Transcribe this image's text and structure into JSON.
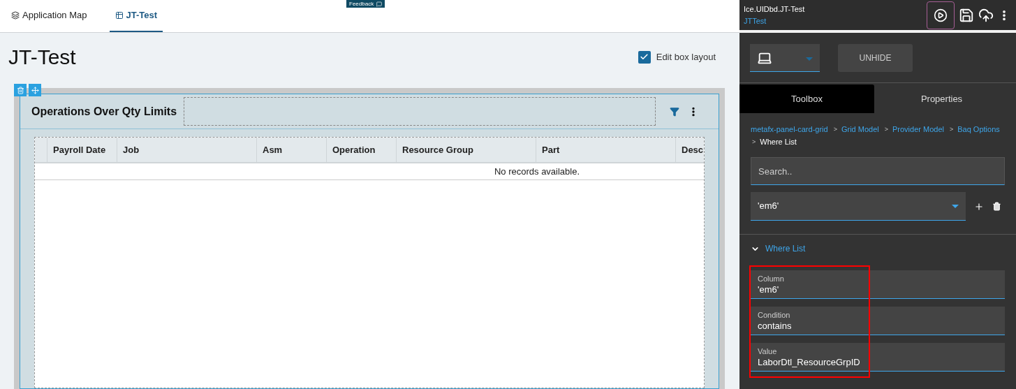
{
  "feedback": {
    "label": "Feedback"
  },
  "tabs": [
    {
      "label": "Application Map",
      "selected": false
    },
    {
      "label": "JT-Test",
      "selected": true
    }
  ],
  "page_title": "JT-Test",
  "edit_box_layout": {
    "label": "Edit box layout",
    "checked": true
  },
  "card": {
    "title": "Operations Over Qty Limits",
    "columns": [
      "Payroll Date",
      "Job",
      "Asm",
      "Operation",
      "Resource Group",
      "Part",
      "Desc"
    ],
    "empty_message": "No records available."
  },
  "designer": {
    "title": "Ice.UIDbd.JT-Test",
    "subtitle": "JTTest",
    "unhide_label": "UNHIDE",
    "panel_tabs": [
      {
        "label": "Toolbox",
        "selected": true
      },
      {
        "label": "Properties",
        "selected": false
      }
    ],
    "breadcrumb": [
      {
        "label": "metafx-panel-card-grid",
        "current": false
      },
      {
        "separator": ">",
        "label": "Grid Model",
        "current": false
      },
      {
        "separator": ">",
        "label": "Provider Model",
        "current": false
      },
      {
        "separator": ">",
        "label": "Baq Options",
        "current": false
      },
      {
        "separator": ">",
        "label": "Where List",
        "current": true
      }
    ],
    "search": {
      "placeholder": "Search.."
    },
    "selected_item": "'em6'",
    "section": {
      "label": "Where List",
      "expanded": true
    },
    "fields": [
      {
        "label": "Column",
        "value": "'em6'"
      },
      {
        "label": "Condition",
        "value": "contains"
      },
      {
        "label": "Value",
        "value": "LaborDtl_ResourceGrpID"
      }
    ]
  }
}
